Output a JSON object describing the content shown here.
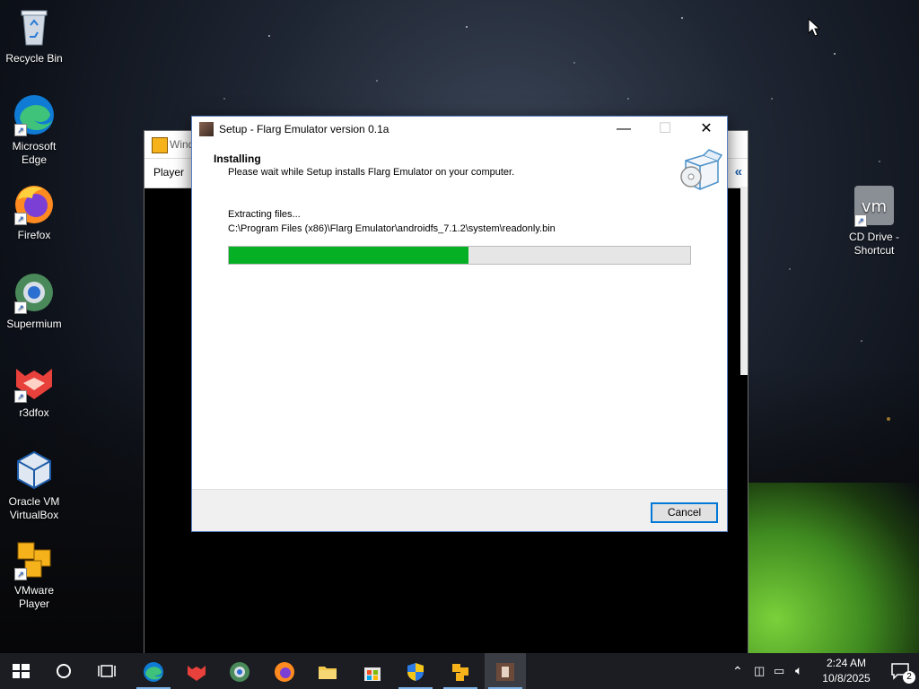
{
  "desktop": {
    "icons": [
      {
        "label": "Recycle Bin"
      },
      {
        "label": "Microsoft Edge"
      },
      {
        "label": "Firefox"
      },
      {
        "label": "Supermium"
      },
      {
        "label": "r3dfox"
      },
      {
        "label": "Oracle VM VirtualBox"
      },
      {
        "label": "VMware Player"
      },
      {
        "label": "CD Drive - Shortcut"
      }
    ]
  },
  "background_window": {
    "title_partial": "Wind",
    "menu_label": "Player",
    "collapse_glyph": "«"
  },
  "setup_dialog": {
    "title": "Setup - Flarg Emulator version 0.1a",
    "heading": "Installing",
    "subheading": "Please wait while Setup installs Flarg Emulator on your computer.",
    "status_line": "Extracting files...",
    "file_path": "C:\\Program Files (x86)\\Flarg Emulator\\androidfs_7.1.2\\system\\readonly.bin",
    "progress_percent": 52,
    "cancel_label": "Cancel",
    "window_buttons": {
      "minimize": "—",
      "maximize": "☐",
      "close": "✕"
    }
  },
  "taskbar": {
    "apps": [
      {
        "name": "start-button"
      },
      {
        "name": "search-button"
      },
      {
        "name": "task-view-button"
      },
      {
        "name": "edge"
      },
      {
        "name": "r3dfox"
      },
      {
        "name": "supermium"
      },
      {
        "name": "firefox"
      },
      {
        "name": "file-explorer"
      },
      {
        "name": "microsoft-store"
      },
      {
        "name": "security-shield"
      },
      {
        "name": "vmware-player"
      },
      {
        "name": "flarg-setup"
      }
    ],
    "clock_time": "2:24 AM",
    "clock_date": "10/8/2025",
    "notification_count": "2"
  },
  "colors": {
    "progress_fill": "#06b025",
    "accent": "#0078d7"
  }
}
